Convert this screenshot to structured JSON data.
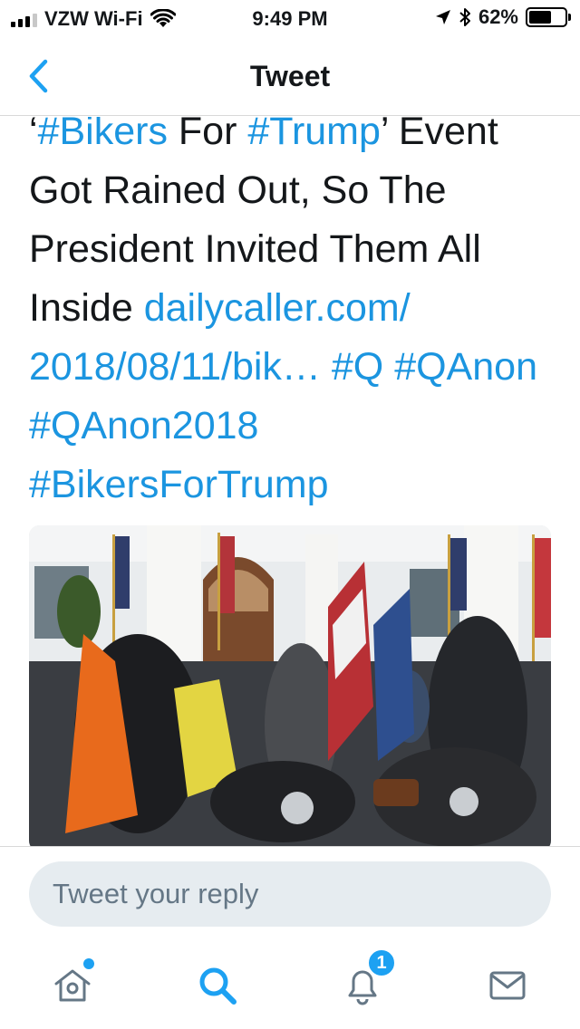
{
  "status_bar": {
    "carrier": "VZW Wi-Fi",
    "time": "9:49 PM",
    "battery_percent": "62%",
    "battery_level": 0.62,
    "icons": [
      "signal-icon",
      "wifi-icon",
      "location-arrow-icon",
      "bluetooth-icon",
      "battery-icon"
    ]
  },
  "nav": {
    "back_icon": "chevron-left-icon",
    "title": "Tweet"
  },
  "tweet": {
    "line1": {
      "open_quote": "‘",
      "hashtag_bikers": "#Bikers",
      "for": " For ",
      "hashtag_trump": "#Trump",
      "rest": "’ Event"
    },
    "line2": "Got Rained Out, So The",
    "line3": "President Invited Them All",
    "line4": {
      "text": "Inside ",
      "link": "dailycaller.com/"
    },
    "line5": {
      "link": "2018/08/11/bik…",
      "tags": " #Q #QAnon"
    },
    "line6": "#QAnon2018",
    "line7": "#BikersForTrump",
    "media": {
      "type": "photo"
    }
  },
  "reply": {
    "placeholder": "Tweet your reply"
  },
  "tab_bar": {
    "tabs": [
      {
        "name": "home",
        "icon": "home-icon",
        "has_dot": true
      },
      {
        "name": "search",
        "icon": "search-icon",
        "active": true
      },
      {
        "name": "notifications",
        "icon": "bell-icon",
        "badge": "1"
      },
      {
        "name": "messages",
        "icon": "envelope-icon"
      }
    ]
  },
  "colors": {
    "link": "#1b95e0",
    "accent": "#1da1f2",
    "text": "#14171a",
    "muted": "#657786",
    "input_bg": "#e6ecf0"
  }
}
